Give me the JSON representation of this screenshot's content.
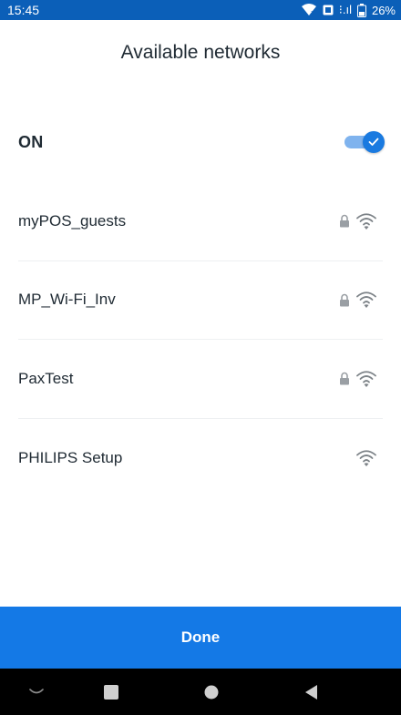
{
  "status_bar": {
    "time": "15:45",
    "signal_text": "⁝.ıl",
    "battery": "26%"
  },
  "header": {
    "title": "Available networks"
  },
  "wifi_toggle": {
    "label": "ON",
    "state": "on",
    "accent_color": "#1a7ae0"
  },
  "networks": [
    {
      "name": "myPOS_guests",
      "secured": true,
      "icon": "wifi-icon"
    },
    {
      "name": "MP_Wi-Fi_Inv",
      "secured": true,
      "icon": "wifi-icon"
    },
    {
      "name": "PaxTest",
      "secured": true,
      "icon": "wifi-icon"
    },
    {
      "name": "PHILIPS Setup",
      "secured": false,
      "icon": "wifi-icon"
    }
  ],
  "footer": {
    "done_label": "Done",
    "button_color": "#1479e6"
  },
  "nav_bar": {
    "icons": [
      "chevron-down-icon",
      "recents-icon",
      "home-icon",
      "back-icon"
    ]
  }
}
